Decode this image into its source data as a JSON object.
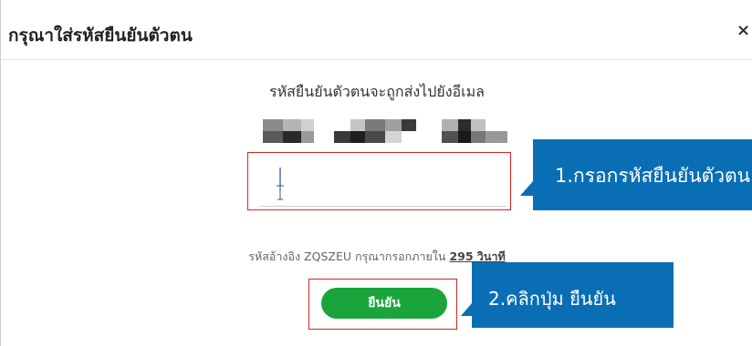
{
  "dialog": {
    "title": "กรุณาใส่รหัสยืนยันตัวตน",
    "close_label": "×",
    "subtitle": "รหัสยืนยันตัวตนจะถูกส่งไปยังอีเมล",
    "otp_value": "",
    "reference_prefix": "รหัสอ้างอิง ZQSZEU กรุณากรอกภายใน",
    "countdown_seconds": "295 วินาที",
    "confirm_label": "ยืนยัน"
  },
  "annotations": {
    "step1": "1.กรอกรหัสยืนยันตัวตน",
    "step2": "2.คลิกปุ่ม ยืนยัน"
  },
  "colors": {
    "confirm_button": "#19a53c",
    "highlight_border": "#e02020",
    "callout": "#0a6eb4"
  }
}
